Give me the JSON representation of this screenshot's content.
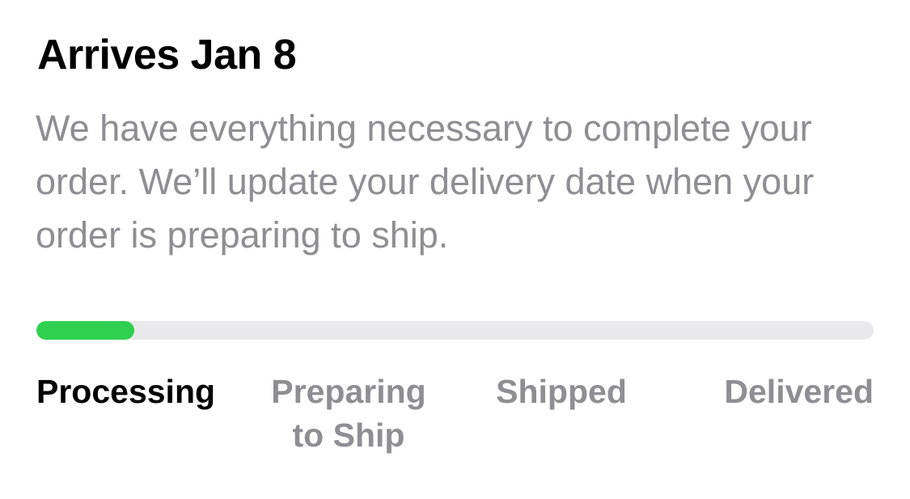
{
  "delivery": {
    "title": "Arrives Jan 8",
    "description": "We have everything necessary to complete your order. We’ll update your delivery date when your order is preparing to ship."
  },
  "progress": {
    "fraction": 0.117,
    "fill_color": "#2fd04f",
    "track_color": "#e9e9eb"
  },
  "steps": [
    {
      "lines": [
        "Processing"
      ],
      "active": true
    },
    {
      "lines": [
        "Preparing",
        "to Ship"
      ],
      "active": false
    },
    {
      "lines": [
        "Shipped"
      ],
      "active": false
    },
    {
      "lines": [
        "Delivered"
      ],
      "active": false
    }
  ],
  "colors": {
    "title": "#000000",
    "muted": "#8e8e93",
    "active_step": "#000000"
  }
}
